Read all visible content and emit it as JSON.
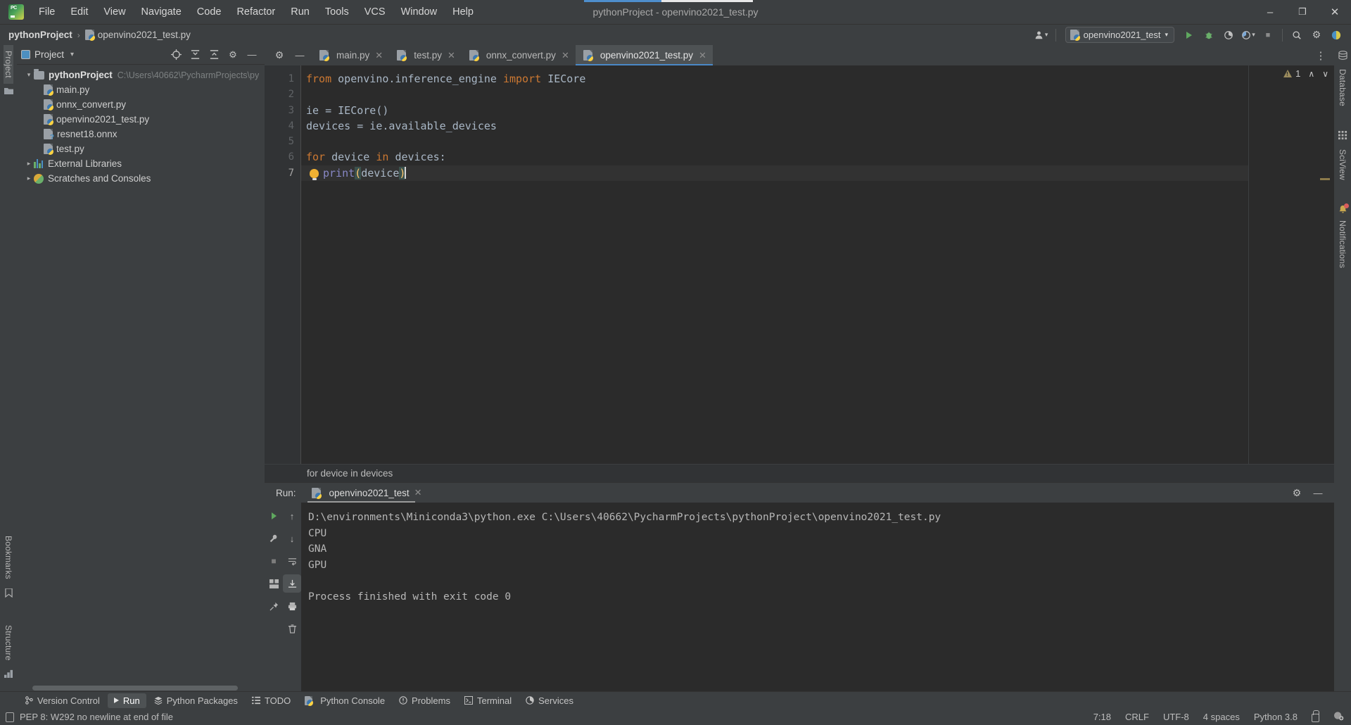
{
  "window": {
    "title": "pythonProject - openvino2021_test.py",
    "minimize": "–",
    "maximize": "❐",
    "close": "✕"
  },
  "menubar": [
    {
      "label": "File"
    },
    {
      "label": "Edit"
    },
    {
      "label": "View"
    },
    {
      "label": "Navigate"
    },
    {
      "label": "Code"
    },
    {
      "label": "Refactor"
    },
    {
      "label": "Run"
    },
    {
      "label": "Tools"
    },
    {
      "label": "VCS"
    },
    {
      "label": "Window"
    },
    {
      "label": "Help"
    }
  ],
  "breadcrumb": {
    "project": "pythonProject",
    "separator": "›",
    "file": "openvino2021_test.py"
  },
  "toolbar": {
    "run_config": "openvino2021_test",
    "run_config_caret": "▾",
    "user_caret": "▾",
    "coverage_caret": "▾",
    "search_icon": "⌕",
    "settings_icon": "⚙",
    "run_icon": "▶",
    "debug_icon": "✲",
    "profile_icon": "◑",
    "coverage_icon": "◔",
    "stop_icon": "■"
  },
  "left_rail": {
    "project_label": "Project",
    "bookmarks_label": "Bookmarks",
    "structure_label": "Structure"
  },
  "right_rail": {
    "database_label": "Database",
    "sciview_label": "SciView",
    "notifications_label": "Notifications"
  },
  "project_panel": {
    "title": "Project",
    "caret": "▾",
    "locate_icon": "⊕",
    "expand_icon": "↧",
    "collapse_icon": "↥",
    "settings_icon": "⚙",
    "hide_icon": "—",
    "tree": [
      {
        "label": "pythonProject",
        "path": "C:\\Users\\40662\\PycharmProjects\\py",
        "type": "folder",
        "expanded": true,
        "indent": 0,
        "bold": true
      },
      {
        "label": "main.py",
        "path": "",
        "type": "python",
        "indent": 1
      },
      {
        "label": "onnx_convert.py",
        "path": "",
        "type": "python",
        "indent": 1
      },
      {
        "label": "openvino2021_test.py",
        "path": "",
        "type": "python",
        "indent": 1
      },
      {
        "label": "resnet18.onnx",
        "path": "",
        "type": "onnx",
        "indent": 1
      },
      {
        "label": "test.py",
        "path": "",
        "type": "python",
        "indent": 1
      },
      {
        "label": "External Libraries",
        "path": "",
        "type": "library",
        "expanded": false,
        "indent": 0
      },
      {
        "label": "Scratches and Consoles",
        "path": "",
        "type": "scratch",
        "expanded": false,
        "indent": 0
      }
    ]
  },
  "editor": {
    "tabs": [
      {
        "label": "main.py",
        "active": false,
        "close": "✕"
      },
      {
        "label": "test.py",
        "active": false,
        "close": "✕"
      },
      {
        "label": "onnx_convert.py",
        "active": false,
        "close": "✕"
      },
      {
        "label": "openvino2021_test.py",
        "active": true,
        "close": "✕"
      }
    ],
    "more_icon": "⋮",
    "line_numbers": [
      "1",
      "2",
      "3",
      "4",
      "5",
      "6",
      "7"
    ],
    "code_lines": [
      {
        "n": 1,
        "tokens": [
          {
            "t": "from ",
            "c": "kw"
          },
          {
            "t": "openvino.inference_engine ",
            "c": "plain"
          },
          {
            "t": "import ",
            "c": "kw"
          },
          {
            "t": "IECore",
            "c": "plain"
          }
        ]
      },
      {
        "n": 2,
        "tokens": []
      },
      {
        "n": 3,
        "tokens": [
          {
            "t": "ie = IECore()",
            "c": "plain"
          }
        ]
      },
      {
        "n": 4,
        "tokens": [
          {
            "t": "devices = ie.available_devices",
            "c": "plain"
          }
        ]
      },
      {
        "n": 5,
        "tokens": []
      },
      {
        "n": 6,
        "tokens": [
          {
            "t": "for ",
            "c": "kw"
          },
          {
            "t": "device ",
            "c": "plain"
          },
          {
            "t": "in ",
            "c": "kw"
          },
          {
            "t": "devices:",
            "c": "plain"
          }
        ]
      },
      {
        "n": 7,
        "tokens": [
          {
            "t": "    ",
            "c": "plain"
          },
          {
            "t": "print",
            "c": "fn"
          },
          {
            "t": "(",
            "c": "paren-hl"
          },
          {
            "t": "device",
            "c": "plain"
          },
          {
            "t": ")",
            "c": "paren-hl"
          }
        ]
      }
    ],
    "inspection_count": "1",
    "inspection_up": "∧",
    "inspection_down": "∨",
    "hint_text": "for device in devices"
  },
  "run_panel": {
    "label": "Run:",
    "tab_name": "openvino2021_test",
    "tab_close": "✕",
    "settings_icon": "⚙",
    "hide_icon": "—",
    "controls": {
      "rerun": "▶",
      "wrench": "ᴠ",
      "stop": "■",
      "up": "↑",
      "down": "↓",
      "soft_wrap": "↵",
      "scroll_end": "↧",
      "print": "⎙",
      "clear": "ᴛ",
      "pin": "✒",
      "grid": "▦"
    },
    "output": [
      "D:\\environments\\Miniconda3\\python.exe C:\\Users\\40662\\PycharmProjects\\pythonProject\\openvino2021_test.py",
      "CPU",
      "GNA",
      "GPU",
      "",
      "Process finished with exit code 0"
    ]
  },
  "tool_windows": [
    {
      "label": "Version Control",
      "icon": "⑂",
      "active": false
    },
    {
      "label": "Run",
      "icon": "▶",
      "active": true
    },
    {
      "label": "Python Packages",
      "icon": "≣",
      "active": false
    },
    {
      "label": "TODO",
      "icon": "≡",
      "active": false
    },
    {
      "label": "Python Console",
      "icon": "ᴘ",
      "active": false
    },
    {
      "label": "Problems",
      "icon": "❗",
      "active": false
    },
    {
      "label": "Terminal",
      "icon": "⌨",
      "active": false
    },
    {
      "label": "Services",
      "icon": "◑",
      "active": false
    }
  ],
  "statusbar": {
    "message": "PEP 8: W292 no newline at end of file",
    "caret_position": "7:18",
    "line_separator": "CRLF",
    "encoding": "UTF-8",
    "indent": "4 spaces",
    "interpreter": "Python 3.8"
  },
  "colors": {
    "accent_blue": "#4a88c7",
    "keyword_orange": "#cc7832",
    "function_violet": "#8888c6",
    "plain_text": "#a9b7c6",
    "panel_bg": "#3c3f41",
    "editor_bg": "#2b2b2b",
    "warning_yellow": "#9a8b5d"
  }
}
